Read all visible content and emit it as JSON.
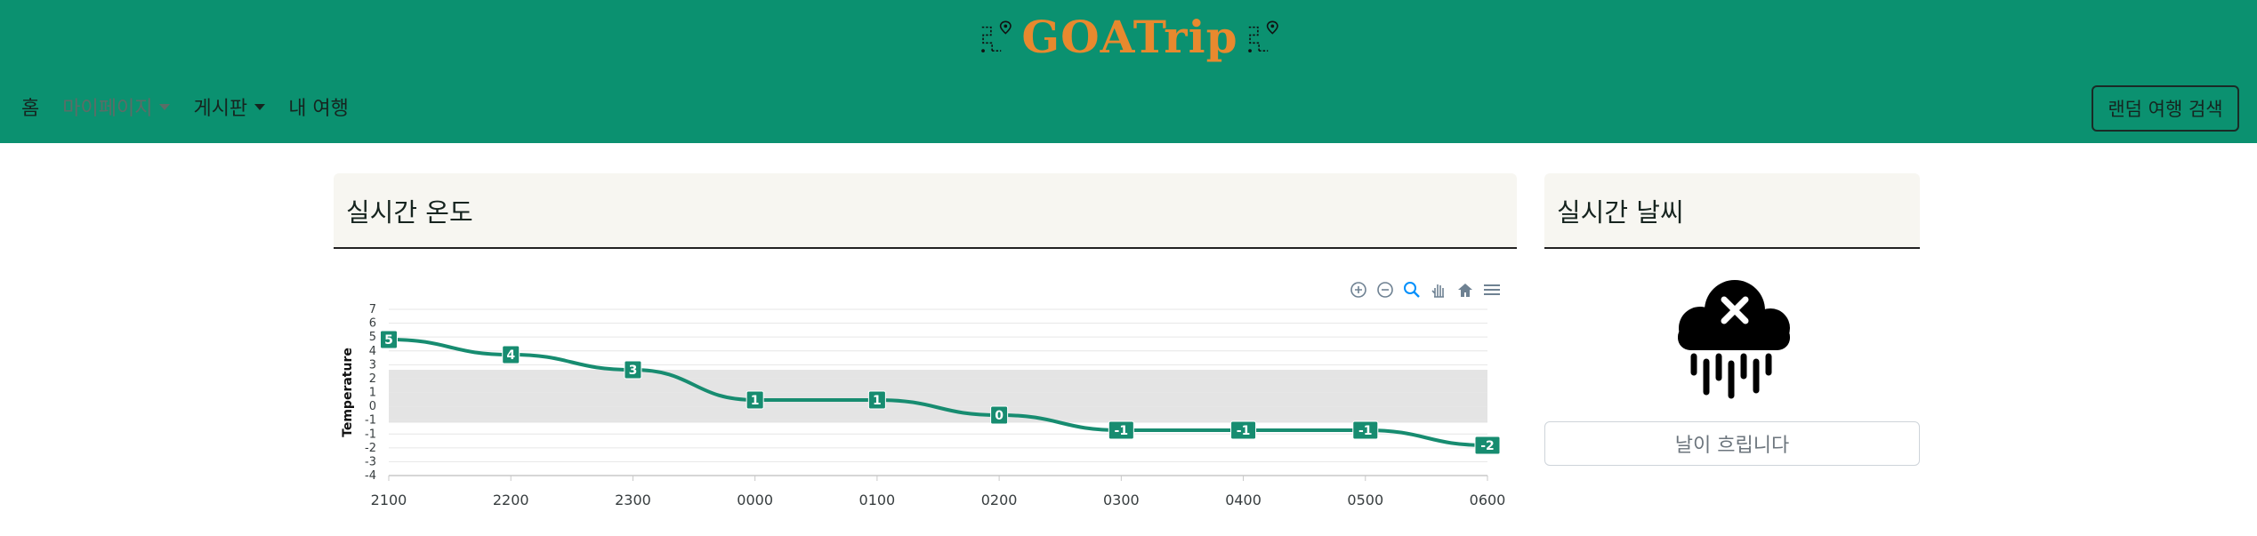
{
  "brand": {
    "name": "GOATrip",
    "color": "#e8892e"
  },
  "navbar": {
    "background": "#0b9170",
    "items": [
      {
        "label": "홈",
        "dropdown": false
      },
      {
        "label": "마이페이지",
        "dropdown": true
      },
      {
        "label": "게시판",
        "dropdown": true
      },
      {
        "label": "내 여행",
        "dropdown": false
      }
    ],
    "random_button": "랜덤 여행 검색"
  },
  "temperature_card": {
    "title": "실시간 온도",
    "toolbar_icons": [
      "zoom-in-icon",
      "zoom-out-icon",
      "zoom-select-icon",
      "pan-icon",
      "home-icon",
      "menu-icon"
    ]
  },
  "weather_card": {
    "title": "실시간 날씨",
    "icon": "rain-cloud-cross-icon",
    "status": "날이 흐립니다"
  },
  "chart_data": {
    "type": "line",
    "title": "",
    "xlabel": "",
    "ylabel": "Temperature",
    "categories": [
      "2100",
      "2200",
      "2300",
      "0000",
      "0100",
      "0200",
      "0300",
      "0400",
      "0500",
      "0600"
    ],
    "series": [
      {
        "values": [
          5,
          4,
          3,
          1,
          1,
          0,
          -1,
          -1,
          -1,
          -2
        ]
      }
    ],
    "ylim": [
      -4,
      7
    ],
    "yticks": [
      7,
      6,
      5,
      4,
      3,
      2,
      1,
      0,
      -1,
      -1,
      -2,
      -3,
      -4
    ],
    "shaded_band": {
      "from": -0.5,
      "to": 3
    },
    "line_color": "#178c70",
    "grid": true,
    "data_labels": true
  }
}
